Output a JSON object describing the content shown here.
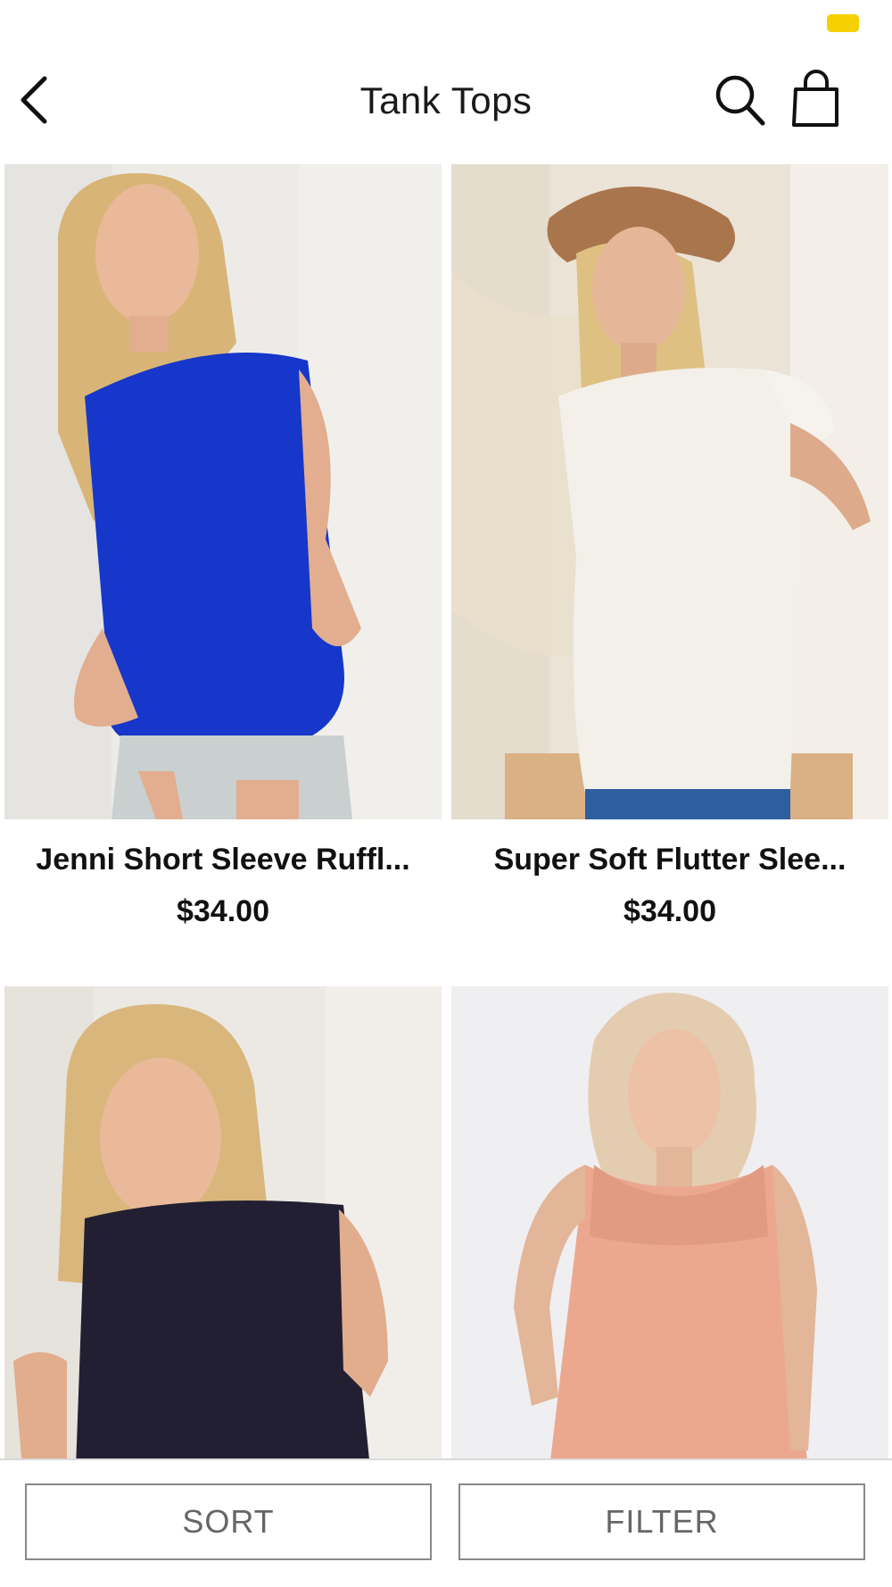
{
  "header": {
    "title": "Tank Tops",
    "back_icon": "chevron-left-icon",
    "search_icon": "search-icon",
    "bag_icon": "shopping-bag-icon"
  },
  "status_bar": {
    "battery_color": "#f5d000"
  },
  "products": [
    {
      "name": "Jenni Short Sleeve Ruffl...",
      "price": "$34.00",
      "top_color": "#1637c9",
      "background_color": "#ecebe8"
    },
    {
      "name": "Super Soft Flutter Slee...",
      "price": "$34.00",
      "top_color": "#f3f0ea",
      "background_color": "#ebe3d6"
    },
    {
      "top_color": "#231f33",
      "background_color": "#ece9e4"
    },
    {
      "top_color": "#eba88f",
      "background_color": "#efeef0"
    }
  ],
  "bottom_bar": {
    "sort_label": "SORT",
    "filter_label": "FILTER"
  }
}
